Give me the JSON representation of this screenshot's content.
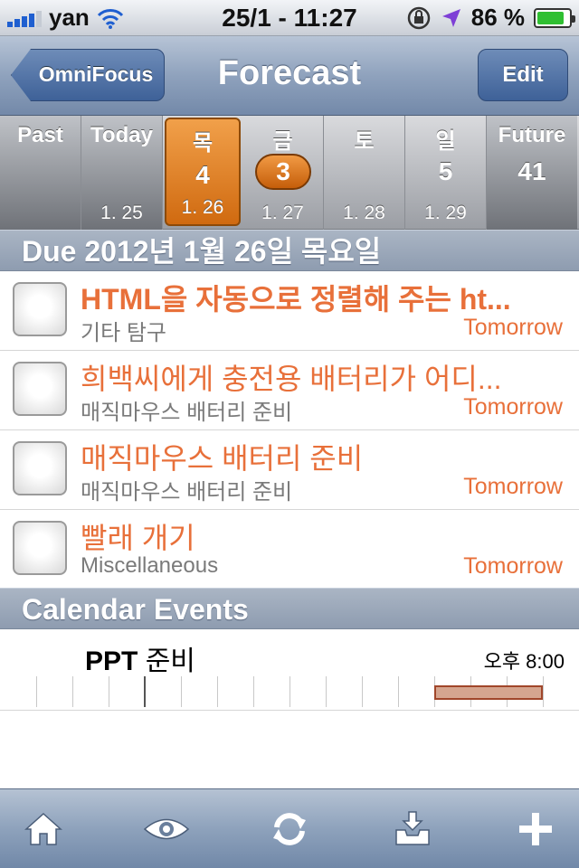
{
  "status_bar": {
    "carrier": "yan",
    "time": "25/1 - 11:27",
    "battery": "86 %",
    "battery_level": 0.86,
    "icons": [
      "signal-icon",
      "wifi-icon",
      "rotation-lock-icon",
      "location-icon",
      "battery-icon"
    ]
  },
  "nav": {
    "back_label": "OmniFocus",
    "title": "Forecast",
    "edit_label": "Edit"
  },
  "forecast": {
    "past": {
      "name": "Past"
    },
    "today": {
      "name": "Today",
      "date": "1. 25"
    },
    "thu": {
      "name": "목",
      "count": "4",
      "date": "1. 26"
    },
    "fri": {
      "name": "금",
      "count": "3",
      "date": "1. 27"
    },
    "sat": {
      "name": "토",
      "date": "1. 28"
    },
    "sun": {
      "name": "일",
      "count": "5",
      "date": "1. 29"
    },
    "future": {
      "name": "Future",
      "count": "41"
    }
  },
  "due_header": "Due 2012년 1월 26일 목요일",
  "tasks": [
    {
      "title": "HTML을 자동으로 정렬해 주는 ht...",
      "context": "기타 탐구",
      "due": "Tomorrow"
    },
    {
      "title": "희백씨에게 충전용 배터리가 어디...",
      "context": "매직마우스 배터리 준비",
      "due": "Tomorrow"
    },
    {
      "title": "매직마우스 배터리 준비",
      "context": "매직마우스 배터리 준비",
      "due": "Tomorrow"
    },
    {
      "title": "빨래 개기",
      "context": "Miscellaneous",
      "due": "Tomorrow"
    }
  ],
  "calendar_header": "Calendar Events",
  "event": {
    "title_bold": "PPT",
    "title_rest": " 준비",
    "time": "오후 8:00"
  },
  "toolbar_icons": [
    "home-icon",
    "eye-icon",
    "sync-icon",
    "inbox-icon",
    "add-icon"
  ],
  "colors": {
    "accent_orange": "#e8703a",
    "nav_blue": "#7389a9",
    "event_bar": "#d5a58f"
  }
}
